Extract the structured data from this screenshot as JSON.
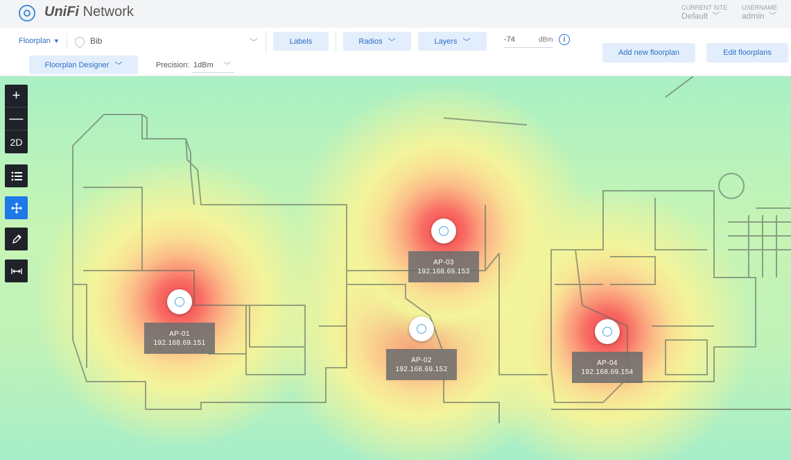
{
  "header": {
    "brand_main": "UniFi",
    "brand_sub": "Network",
    "current_site_label": "CURRENT SITE",
    "current_site_value": "Default",
    "username_label": "USERNAME",
    "username_value": "admin"
  },
  "toolbar": {
    "floorplan_menu": "Floorplan",
    "floor_name": "Bib",
    "labels_button": "Labels",
    "radios_button": "Radios",
    "layers_button": "Layers",
    "signal_value": "-74",
    "signal_unit": "dBm",
    "info_glyph": "i",
    "add_floorplan_button": "Add new floorplan",
    "edit_floorplans_button": "Edit floorplans",
    "designer_button": "Floorplan Designer",
    "precision_label": "Precision:",
    "precision_value": "1dBm"
  },
  "map_controls": {
    "zoom_in": "+",
    "zoom_out": "—",
    "view_mode": "2D",
    "list_icon": "list-icon",
    "move_icon": "move-icon",
    "pencil_icon": "pencil-icon",
    "measure_icon": "measure-icon"
  },
  "access_points": [
    {
      "name": "AP-01",
      "ip": "192.168.69.151"
    },
    {
      "name": "AP-02",
      "ip": "192.168.69.152"
    },
    {
      "name": "AP-03",
      "ip": "192.168.69.153"
    },
    {
      "name": "AP-04",
      "ip": "192.168.69.154"
    }
  ],
  "colors": {
    "accent": "#2c6fc7",
    "pill_bg": "#e2eefb",
    "control_dark": "#1f2329",
    "control_active": "#1e78e8",
    "heat_core": "#f5454f",
    "heat_edge": "#a9f0c4"
  }
}
